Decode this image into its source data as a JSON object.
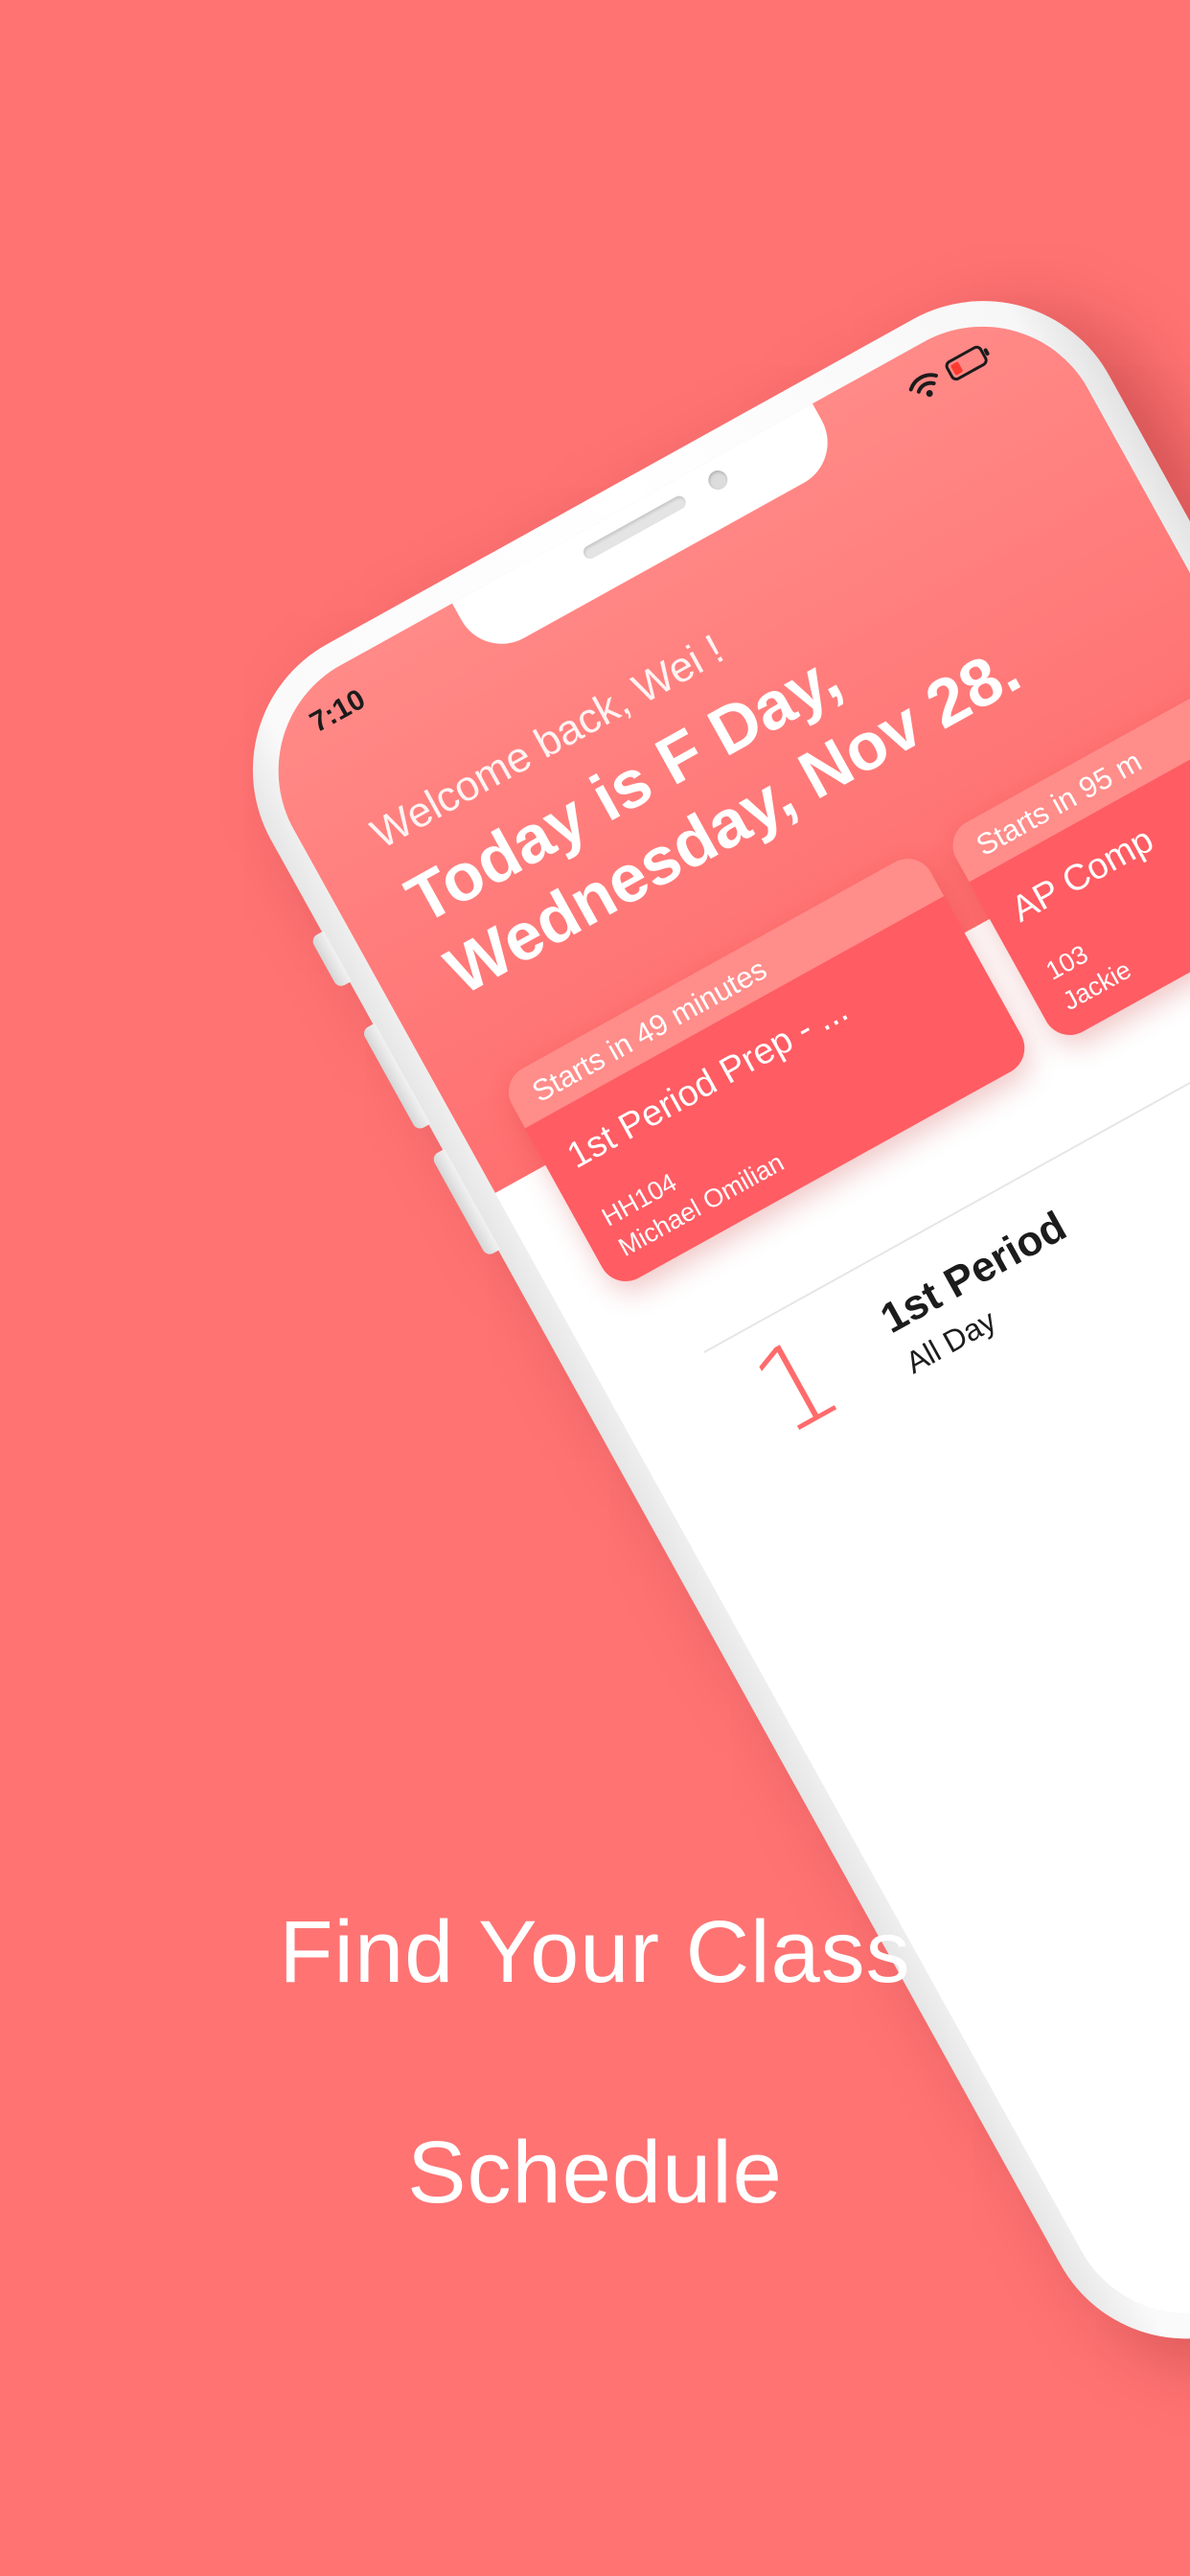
{
  "caption": {
    "line1": "Find Your Class",
    "line2": "Schedule"
  },
  "status_bar": {
    "time": "7:10",
    "icons": [
      "wifi-icon",
      "battery-icon"
    ]
  },
  "header": {
    "welcome": "Welcome back, Wei !",
    "today_line": "Today is F Day,",
    "date_line": "Wednesday, Nov 28."
  },
  "cards": [
    {
      "starts_in": "Starts in 49 minutes",
      "title": "1st Period Prep - ...",
      "room": "HH104",
      "teacher": "Michael Omilian"
    },
    {
      "starts_in": "Starts in 95 m",
      "title": "AP Comp",
      "room": "103",
      "teacher": "Jackie"
    }
  ],
  "schedule": {
    "period_number": "1",
    "period_title": "1st Period",
    "period_time": "All Day"
  },
  "colors": {
    "background": "#ff7373",
    "header": "#ff7f7c",
    "card": "#ff5c63",
    "card_top": "#ff8d8a",
    "accent": "#ff6b6b"
  }
}
